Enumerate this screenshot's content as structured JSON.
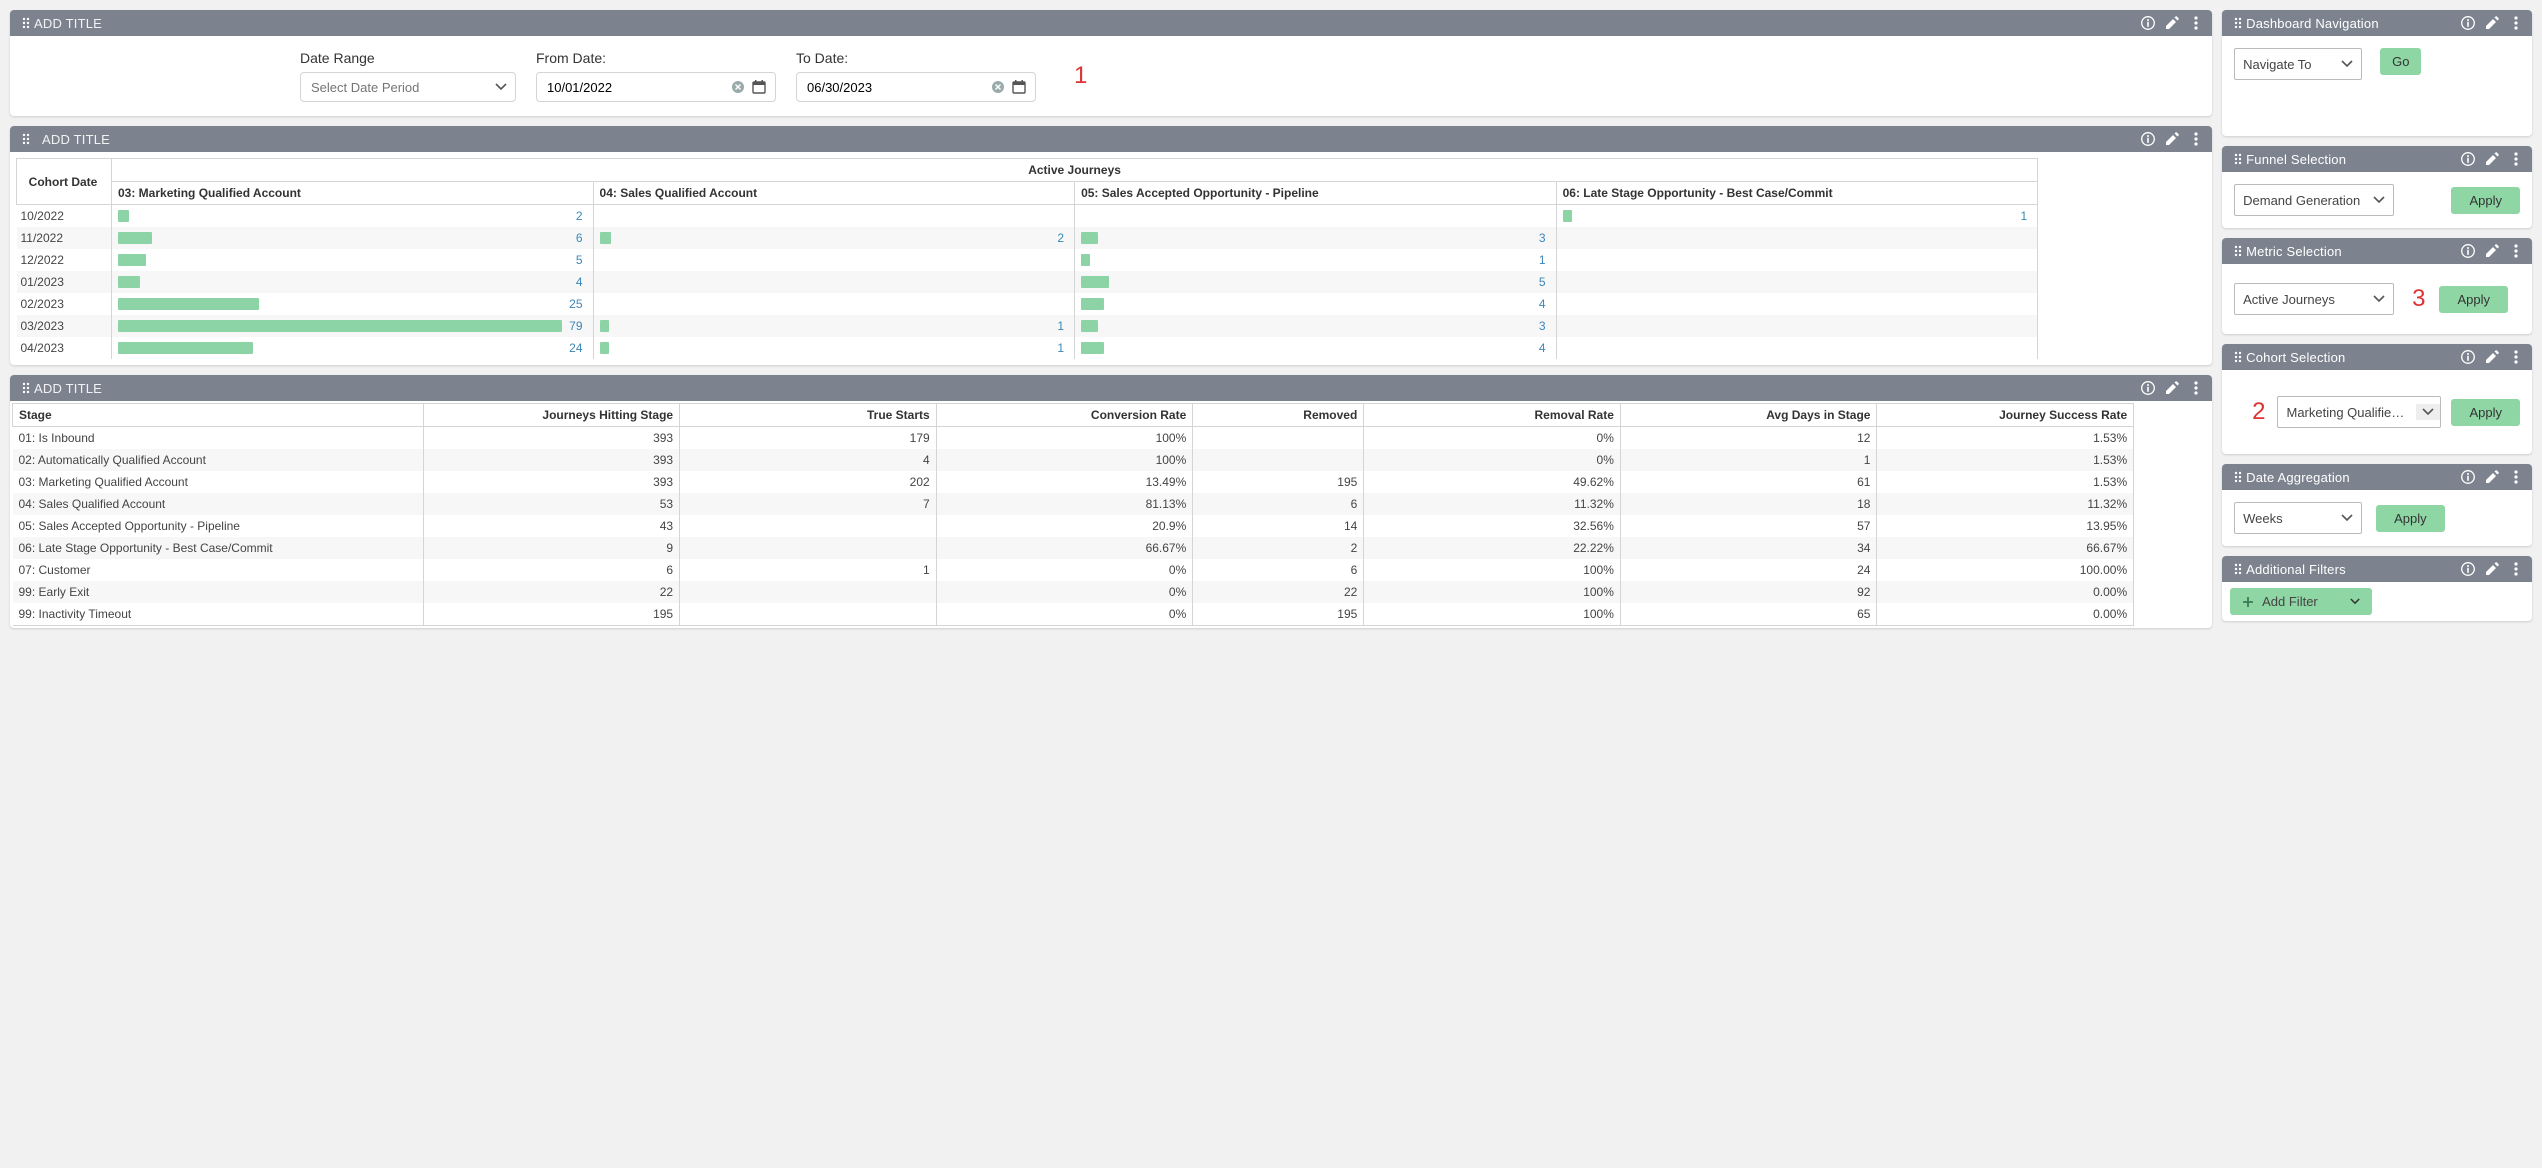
{
  "panels": {
    "date": {
      "title": "ADD TITLE"
    },
    "chart": {
      "title": "ADD TITLE"
    },
    "table": {
      "title": "ADD TITLE"
    },
    "nav": {
      "title": "Dashboard Navigation"
    },
    "funnel": {
      "title": "Funnel Selection"
    },
    "metric": {
      "title": "Metric Selection"
    },
    "cohort": {
      "title": "Cohort Selection"
    },
    "agg": {
      "title": "Date Aggregation"
    },
    "filters": {
      "title": "Additional Filters"
    }
  },
  "date_filter": {
    "range_label": "Date Range",
    "range_placeholder": "Select Date Period",
    "from_label": "From Date:",
    "to_label": "To Date:",
    "from_value": "10/01/2022",
    "to_value": "06/30/2023",
    "annotation": "1"
  },
  "chart": {
    "cohort_header": "Cohort Date",
    "group_header": "Active Journeys",
    "series_headers": [
      "03: Marketing Qualified Account",
      "04: Sales Qualified Account",
      "05: Sales Accepted Opportunity - Pipeline",
      "06: Late Stage Opportunity - Best Case/Commit"
    ],
    "rows": [
      {
        "cohort": "10/2022",
        "v": [
          2,
          null,
          null,
          1
        ]
      },
      {
        "cohort": "11/2022",
        "v": [
          6,
          2,
          3,
          null
        ]
      },
      {
        "cohort": "12/2022",
        "v": [
          5,
          null,
          1,
          null
        ]
      },
      {
        "cohort": "01/2023",
        "v": [
          4,
          null,
          5,
          null
        ]
      },
      {
        "cohort": "02/2023",
        "v": [
          25,
          null,
          4,
          null
        ]
      },
      {
        "cohort": "03/2023",
        "v": [
          79,
          1,
          3,
          null
        ]
      },
      {
        "cohort": "04/2023",
        "v": [
          24,
          1,
          4,
          null
        ]
      }
    ],
    "max": 80
  },
  "chart_data": {
    "type": "bar",
    "title": "",
    "group_header": "Active Journeys",
    "categories": [
      "10/2022",
      "11/2022",
      "12/2022",
      "01/2023",
      "02/2023",
      "03/2023",
      "04/2023"
    ],
    "series": [
      {
        "name": "03: Marketing Qualified Account",
        "values": [
          2,
          6,
          5,
          4,
          25,
          79,
          24
        ]
      },
      {
        "name": "04: Sales Qualified Account",
        "values": [
          null,
          2,
          null,
          null,
          null,
          1,
          1
        ]
      },
      {
        "name": "05: Sales Accepted Opportunity - Pipeline",
        "values": [
          null,
          3,
          1,
          5,
          4,
          3,
          4
        ]
      },
      {
        "name": "06: Late Stage Opportunity - Best Case/Commit",
        "values": [
          1,
          null,
          null,
          null,
          null,
          null,
          null
        ]
      }
    ],
    "xlabel": "Cohort Date",
    "ylabel": "",
    "ylim": [
      0,
      80
    ]
  },
  "table": {
    "headers": [
      "Stage",
      "Journeys Hitting Stage",
      "True Starts",
      "Conversion Rate",
      "Removed",
      "Removal Rate",
      "Avg Days in Stage",
      "Journey Success Rate"
    ],
    "rows": [
      [
        "01: Is Inbound",
        "393",
        "179",
        "100%",
        "",
        "0%",
        "12",
        "1.53%"
      ],
      [
        "02: Automatically Qualified Account",
        "393",
        "4",
        "100%",
        "",
        "0%",
        "1",
        "1.53%"
      ],
      [
        "03: Marketing Qualified Account",
        "393",
        "202",
        "13.49%",
        "195",
        "49.62%",
        "61",
        "1.53%"
      ],
      [
        "04: Sales Qualified Account",
        "53",
        "7",
        "81.13%",
        "6",
        "11.32%",
        "18",
        "11.32%"
      ],
      [
        "05: Sales Accepted Opportunity - Pipeline",
        "43",
        "",
        "20.9%",
        "14",
        "32.56%",
        "57",
        "13.95%"
      ],
      [
        "06: Late Stage Opportunity - Best Case/Commit",
        "9",
        "",
        "66.67%",
        "2",
        "22.22%",
        "34",
        "66.67%"
      ],
      [
        "07: Customer",
        "6",
        "1",
        "0%",
        "6",
        "100%",
        "24",
        "100.00%"
      ],
      [
        "99: Early Exit",
        "22",
        "",
        "0%",
        "22",
        "100%",
        "92",
        "0.00%"
      ],
      [
        "99: Inactivity Timeout",
        "195",
        "",
        "0%",
        "195",
        "100%",
        "65",
        "0.00%"
      ]
    ]
  },
  "side": {
    "navigate_placeholder": "Navigate To",
    "go": "Go",
    "funnel_value": "Demand Generation",
    "metric_value": "Active Journeys",
    "metric_annotation": "3",
    "cohort_value": "Marketing Qualified Ac...",
    "cohort_annotation": "2",
    "agg_value": "Weeks",
    "apply": "Apply",
    "add_filter": "Add Filter"
  }
}
